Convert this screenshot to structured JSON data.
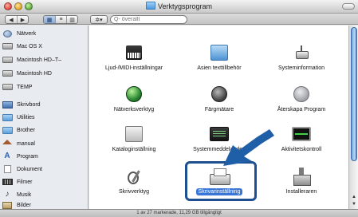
{
  "window": {
    "title": "Verktygsprogram",
    "status_text": "1 av 27 markerade, 11,29 GB tillgängligt"
  },
  "toolbar": {
    "nav": [
      {
        "icon": "back-arrow-icon",
        "glyph": "◀"
      },
      {
        "icon": "forward-arrow-icon",
        "glyph": "▶"
      }
    ],
    "views": [
      {
        "icon": "icon-view-icon",
        "glyph": "▦",
        "selected": true
      },
      {
        "icon": "list-view-icon",
        "glyph": "≡",
        "selected": false
      },
      {
        "icon": "column-view-icon",
        "glyph": "▥",
        "selected": false
      }
    ],
    "action": {
      "icon": "gear-icon",
      "glyph": "✲▾"
    },
    "search": {
      "placeholder": "Q- överallt"
    }
  },
  "sidebar": {
    "items": [
      {
        "label": "Nätverk",
        "icon": "network-icon"
      },
      {
        "label": "Mac OS X",
        "icon": "disk-icon"
      },
      {
        "label": "Macintosh HD–T–",
        "icon": "disk-icon"
      },
      {
        "label": "Macintosh HD",
        "icon": "disk-icon"
      },
      {
        "label": "TEMP",
        "icon": "disk-icon"
      },
      {
        "label": "Skrivbord",
        "icon": "desktop-icon"
      },
      {
        "label": "Utilities",
        "icon": "folder-icon"
      },
      {
        "label": "Brother",
        "icon": "folder-icon"
      },
      {
        "label": "manual",
        "icon": "home-icon"
      },
      {
        "label": "Program",
        "icon": "applications-icon"
      },
      {
        "label": "Dokument",
        "icon": "document-icon"
      },
      {
        "label": "Filmer",
        "icon": "film-icon"
      },
      {
        "label": "Musik",
        "icon": "music-icon"
      },
      {
        "label": "Bilder",
        "icon": "pictures-icon"
      }
    ]
  },
  "apps": [
    {
      "label": "Ljud-/MIDI-inställningar",
      "icon": "midi-icon"
    },
    {
      "label": "Asien texttillbehör",
      "icon": "asian-text-icon"
    },
    {
      "label": "Systeminformation",
      "icon": "system-info-icon"
    },
    {
      "label": "Nätverksverktyg",
      "icon": "network-utility-icon"
    },
    {
      "label": "Färgmätare",
      "icon": "color-meter-icon"
    },
    {
      "label": "Återskapa Program",
      "icon": "restore-icon"
    },
    {
      "label": "Kataloginställning",
      "icon": "directory-setup-icon"
    },
    {
      "label": "Systemmeddelanden",
      "icon": "console-icon"
    },
    {
      "label": "Aktivitetskontroll",
      "icon": "activity-monitor-icon"
    },
    {
      "label": "Skrivverktyg",
      "icon": "tools-icon"
    },
    {
      "label": "Skrivarinställning",
      "icon": "printer-setup-icon",
      "selected": true
    },
    {
      "label": "Installeraren",
      "icon": "installer-icon"
    }
  ],
  "colors": {
    "selection": "#3a76d6",
    "highlight_border": "#1d4f91",
    "arrow": "#1f5fa8"
  }
}
